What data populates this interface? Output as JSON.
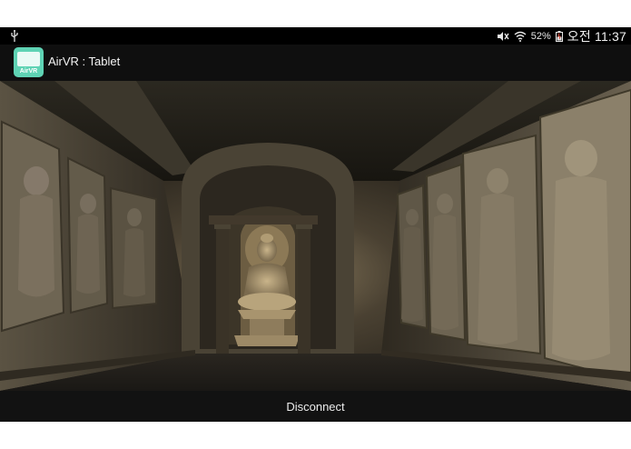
{
  "status_bar": {
    "battery": "52%",
    "clock": "오전 11:37",
    "icons": [
      "usb-icon",
      "mute-icon",
      "wifi-icon",
      "battery-icon"
    ]
  },
  "action_bar": {
    "app_icon_text": "AirVR",
    "title": "AirVR : Tablet"
  },
  "scene": {
    "description_icon": "buddha-grotto-vr-view"
  },
  "bottom_bar": {
    "disconnect_label": "Disconnect"
  }
}
